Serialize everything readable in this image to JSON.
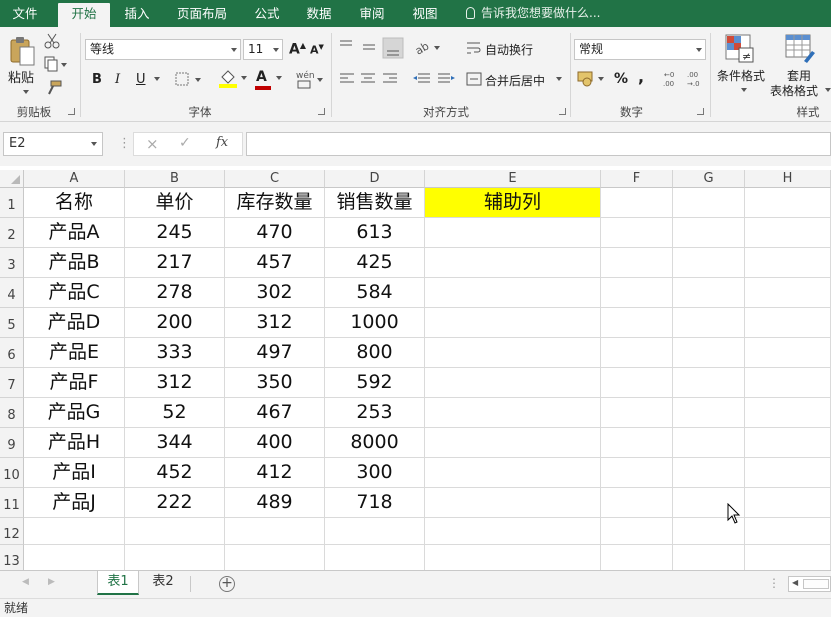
{
  "menu": {
    "tabs": [
      "文件",
      "开始",
      "插入",
      "页面布局",
      "公式",
      "数据",
      "审阅",
      "视图"
    ],
    "active": "开始",
    "tell_me": "告诉我您想要做什么..."
  },
  "ribbon": {
    "clipboard": {
      "paste": "粘贴",
      "group": "剪贴板"
    },
    "font": {
      "family": "等线",
      "size": "11",
      "bold": "B",
      "italic": "I",
      "underline": "U",
      "grow": "A",
      "shrink": "A",
      "font_color_letter": "A",
      "group": "字体",
      "fill_color": "#ffff00",
      "text_color": "#c00000"
    },
    "alignment": {
      "wrap": "自动换行",
      "merge": "合并后居中",
      "group": "对齐方式"
    },
    "number": {
      "format": "常规",
      "percent": "%",
      "comma": ",",
      "group": "数字"
    },
    "styles": {
      "conditional": "条件格式",
      "table_format_1": "套用",
      "table_format_2": "表格格式",
      "group": "样式"
    }
  },
  "formula_bar": {
    "name_box": "E2",
    "cancel": "×",
    "enter": "✓",
    "fx": "fx",
    "formula": ""
  },
  "grid": {
    "columns": [
      "A",
      "B",
      "C",
      "D",
      "E",
      "F",
      "G",
      "H"
    ],
    "rows": [
      "1",
      "2",
      "3",
      "4",
      "5",
      "6",
      "7",
      "8",
      "9",
      "10",
      "11",
      "12",
      "13"
    ],
    "header_row": [
      "名称",
      "单价",
      "库存数量",
      "销售数量",
      "辅助列"
    ],
    "highlight_color": "#ffff00",
    "data": [
      [
        "产品A",
        "245",
        "470",
        "613"
      ],
      [
        "产品B",
        "217",
        "457",
        "425"
      ],
      [
        "产品C",
        "278",
        "302",
        "584"
      ],
      [
        "产品D",
        "200",
        "312",
        "1000"
      ],
      [
        "产品E",
        "333",
        "497",
        "800"
      ],
      [
        "产品F",
        "312",
        "350",
        "592"
      ],
      [
        "产品G",
        "52",
        "467",
        "253"
      ],
      [
        "产品H",
        "344",
        "400",
        "8000"
      ],
      [
        "产品I",
        "452",
        "412",
        "300"
      ],
      [
        "产品J",
        "222",
        "489",
        "718"
      ]
    ]
  },
  "sheets": {
    "tabs": [
      "表1",
      "表2"
    ],
    "active": "表1",
    "add": "+"
  },
  "status": {
    "text": "就绪"
  },
  "accent": "#217346"
}
